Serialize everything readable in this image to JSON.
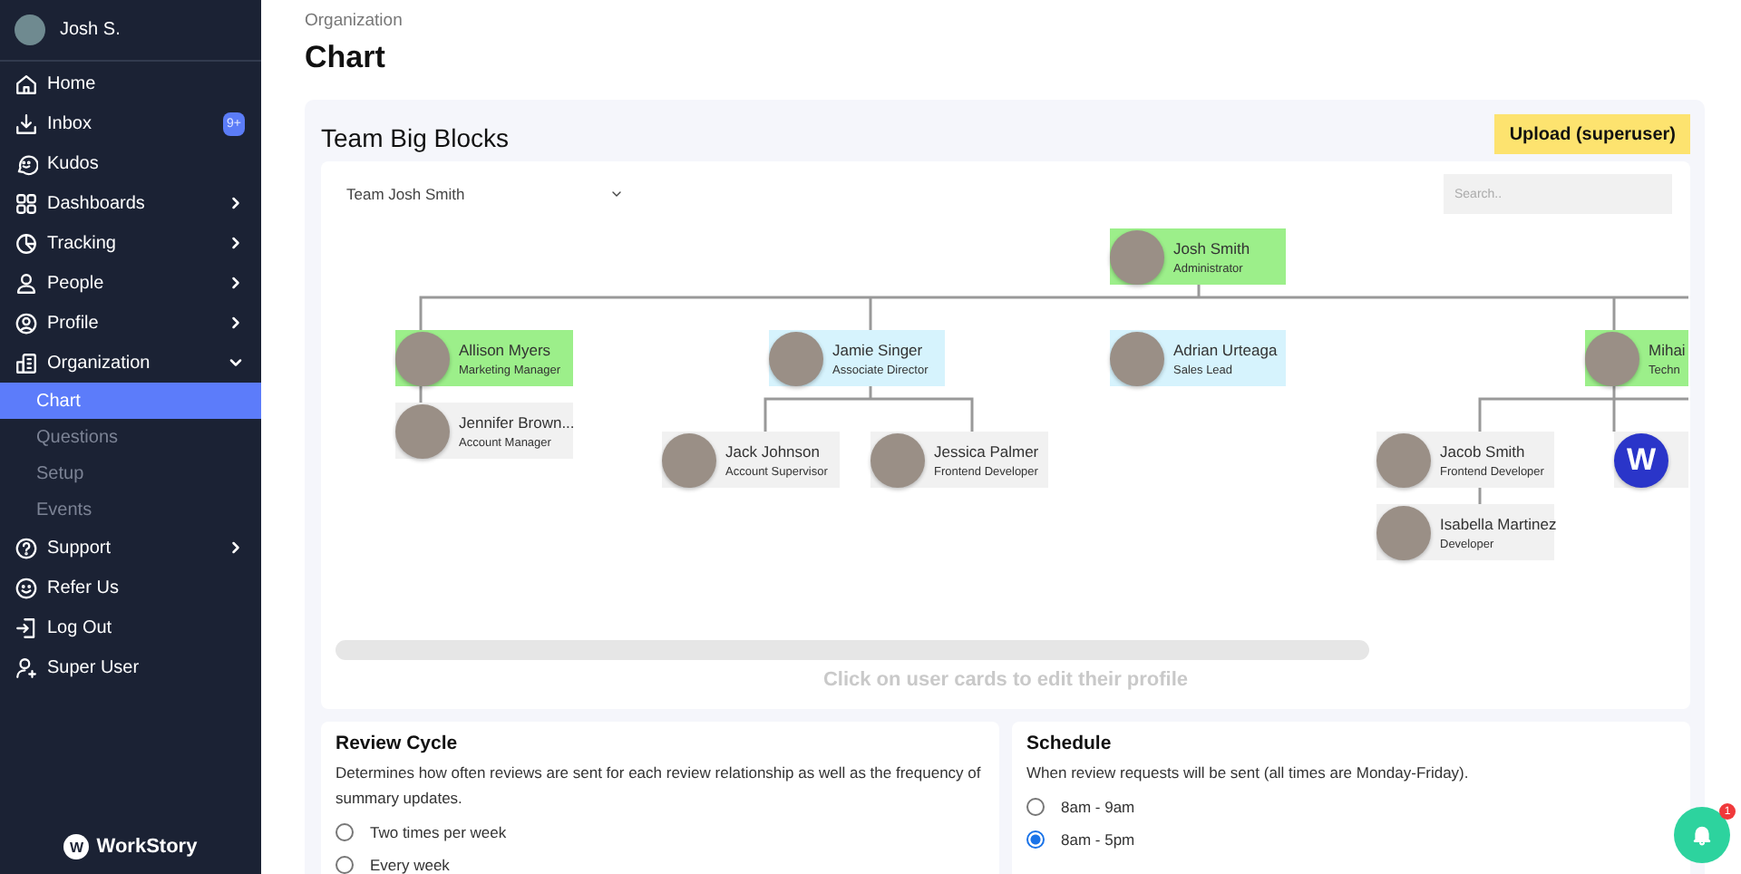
{
  "sidebar": {
    "user": {
      "name": "Josh S."
    },
    "items": [
      {
        "label": "Home",
        "selected": false
      },
      {
        "label": "Inbox",
        "selected": false,
        "badge": "9+"
      },
      {
        "label": "Kudos",
        "selected": false
      },
      {
        "label": "Dashboards",
        "selected": false,
        "expanded": false
      },
      {
        "label": "Tracking",
        "selected": false,
        "expanded": false
      },
      {
        "label": "People",
        "selected": false,
        "expanded": false
      },
      {
        "label": "Profile",
        "selected": false,
        "expanded": false
      },
      {
        "label": "Organization",
        "selected": false,
        "expanded": true,
        "children": [
          {
            "label": "Chart",
            "selected": true
          },
          {
            "label": "Questions",
            "selected": false
          },
          {
            "label": "Setup",
            "selected": false
          },
          {
            "label": "Events",
            "selected": false
          }
        ]
      },
      {
        "label": "Support",
        "selected": false,
        "expanded": false
      },
      {
        "label": "Refer Us",
        "selected": false
      },
      {
        "label": "Log Out",
        "selected": false
      },
      {
        "label": "Super User",
        "selected": false
      }
    ],
    "logo": {
      "initial": "W",
      "name": "WorkStory"
    }
  },
  "header": {
    "breadcrumb": "Organization",
    "title": "Chart"
  },
  "team": {
    "title": "Team Big Blocks",
    "upload_button": "Upload (superuser)",
    "team_select": "Team Josh Smith",
    "search": {
      "placeholder": "Search.."
    },
    "org_chart": {
      "name": "Josh Smith",
      "title": "Administrator",
      "color": "#9cef8a",
      "children": [
        {
          "name": "Allison Myers",
          "title": "Marketing Manager",
          "color": "#9cef8a",
          "children": [
            {
              "name": "Jennifer Brown...",
              "title": "Account Manager",
              "color": "#f1f1f1"
            }
          ]
        },
        {
          "name": "Jamie Singer",
          "title": "Associate Director",
          "color": "#d6f3fd",
          "children": [
            {
              "name": "Jack Johnson",
              "title": "Account Supervisor",
              "color": "#f1f1f1"
            },
            {
              "name": "Jessica Palmer",
              "title": "Frontend Developer",
              "color": "#f1f1f1"
            }
          ]
        },
        {
          "name": "Adrian Urteaga",
          "title": "Sales Lead",
          "color": "#d6f3fd"
        },
        {
          "name": "Mihai",
          "title": "Techn",
          "color": "#9cef8a",
          "children": [
            {
              "name": "Jacob Smith",
              "title": "Frontend Developer",
              "color": "#f1f1f1",
              "children": [
                {
                  "name": "Isabella Martinez",
                  "title": "Developer",
                  "color": "#f1f1f1"
                }
              ]
            },
            {
              "initial": "W",
              "color": "#f1f1f1"
            }
          ]
        }
      ]
    },
    "hint": "Click on user cards to edit their profile"
  },
  "review_cycle": {
    "title": "Review Cycle",
    "description": "Determines how often reviews are sent for each review relationship as well as the frequency of summary updates.",
    "options": [
      {
        "label": "Two times per week",
        "selected": false
      },
      {
        "label": "Every week",
        "selected": false
      }
    ]
  },
  "schedule": {
    "title": "Schedule",
    "description": "When review requests will be sent (all times are Monday-Friday).",
    "options": [
      {
        "label": "8am - 9am",
        "selected": false
      },
      {
        "label": "8am - 5pm",
        "selected": true
      }
    ]
  },
  "notifications": {
    "badge": "1"
  }
}
